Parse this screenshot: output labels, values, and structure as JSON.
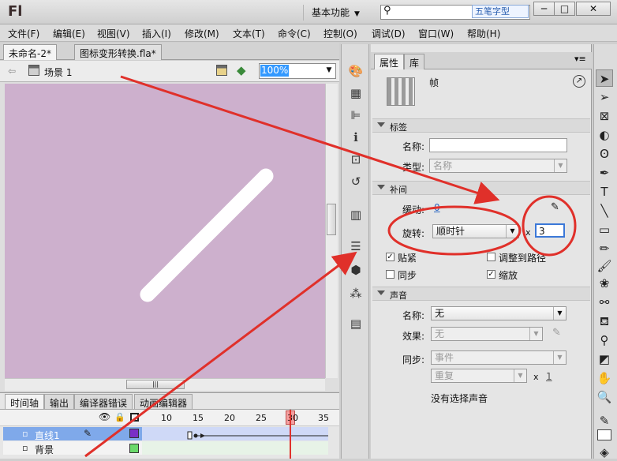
{
  "app": {
    "logo": "Fl",
    "workspace": "基本功能",
    "watermark": "五笔字型"
  },
  "window_buttons": [
    "─",
    "□",
    "✕"
  ],
  "menu": [
    "文件(F)",
    "编辑(E)",
    "视图(V)",
    "插入(I)",
    "修改(M)",
    "文本(T)",
    "命令(C)",
    "控制(O)",
    "调试(D)",
    "窗口(W)",
    "帮助(H)"
  ],
  "doc_tabs": [
    {
      "label": "未命名-2*",
      "active": true
    },
    {
      "label": "图标变形转换.fla*",
      "active": false
    }
  ],
  "editbar": {
    "scene": "场景 1",
    "zoom": "100%"
  },
  "timeline": {
    "tabs": [
      "时间轴",
      "输出",
      "编译器错误",
      "动画编辑器"
    ],
    "frame_numbers": [
      "10",
      "15",
      "20",
      "25",
      "30",
      "35"
    ],
    "layers": [
      {
        "name": "直线1",
        "selected": true
      },
      {
        "name": "背景",
        "selected": false
      }
    ]
  },
  "properties": {
    "tabs": [
      "属性",
      "库"
    ],
    "header": "帧",
    "sections": {
      "label": "标签",
      "tween": "补间",
      "sound": "声音"
    },
    "label_section": {
      "name_label": "名称:",
      "name_value": "",
      "type_label": "类型:",
      "type_value": "名称"
    },
    "tween_section": {
      "ease_label": "缓动:",
      "ease_value": "0",
      "rotate_label": "旋转:",
      "rotate_value": "顺时针",
      "times_symbol": "x",
      "times_value": "3",
      "snap": "贴紧",
      "orient": "调整到路径",
      "sync": "同步",
      "scale": "缩放",
      "snap_checked": true,
      "orient_checked": false,
      "sync_checked": false,
      "scale_checked": true
    },
    "sound_section": {
      "name_label": "名称:",
      "name_value": "无",
      "effect_label": "效果:",
      "effect_value": "无",
      "sync_label": "同步:",
      "sync_value": "事件",
      "repeat_value": "重复",
      "repeat_x": "x",
      "repeat_count": "1",
      "status": "没有选择声音"
    }
  },
  "colors": {
    "stage": "#cdb0cd",
    "annotation_red": "#e0302a",
    "selected_layer": "#7fa9ea"
  }
}
